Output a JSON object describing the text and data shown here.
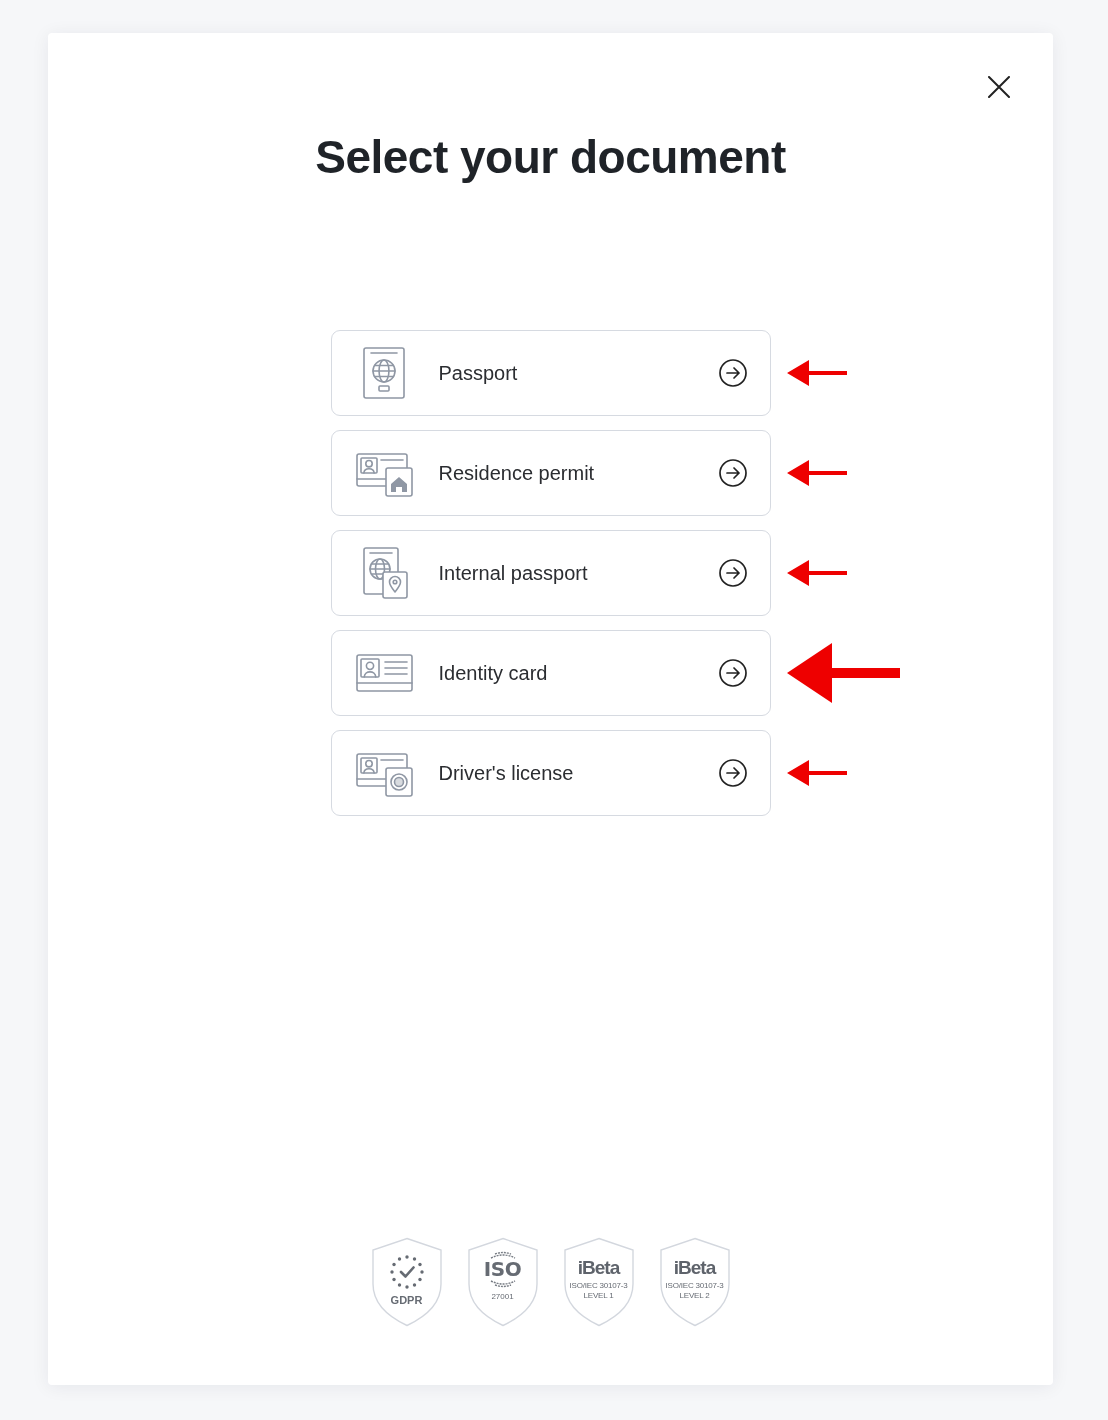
{
  "dialog": {
    "title": "Select your document"
  },
  "documents": [
    {
      "label": "Passport",
      "highlighted": false
    },
    {
      "label": "Residence permit",
      "highlighted": false
    },
    {
      "label": "Internal passport",
      "highlighted": false
    },
    {
      "label": "Identity card",
      "highlighted": true
    },
    {
      "label": "Driver's license",
      "highlighted": false
    }
  ],
  "badges": [
    {
      "kind": "seal",
      "captions": [
        "GDPR"
      ]
    },
    {
      "kind": "wreath",
      "title": "ISO",
      "captions": [
        "27001"
      ]
    },
    {
      "kind": "wordmark",
      "title": "iBeta",
      "captions": [
        "ISO/IEC 30107-3",
        "LEVEL 1"
      ]
    },
    {
      "kind": "wordmark",
      "title": "iBeta",
      "captions": [
        "ISO/IEC 30107-3",
        "LEVEL 2"
      ]
    }
  ]
}
